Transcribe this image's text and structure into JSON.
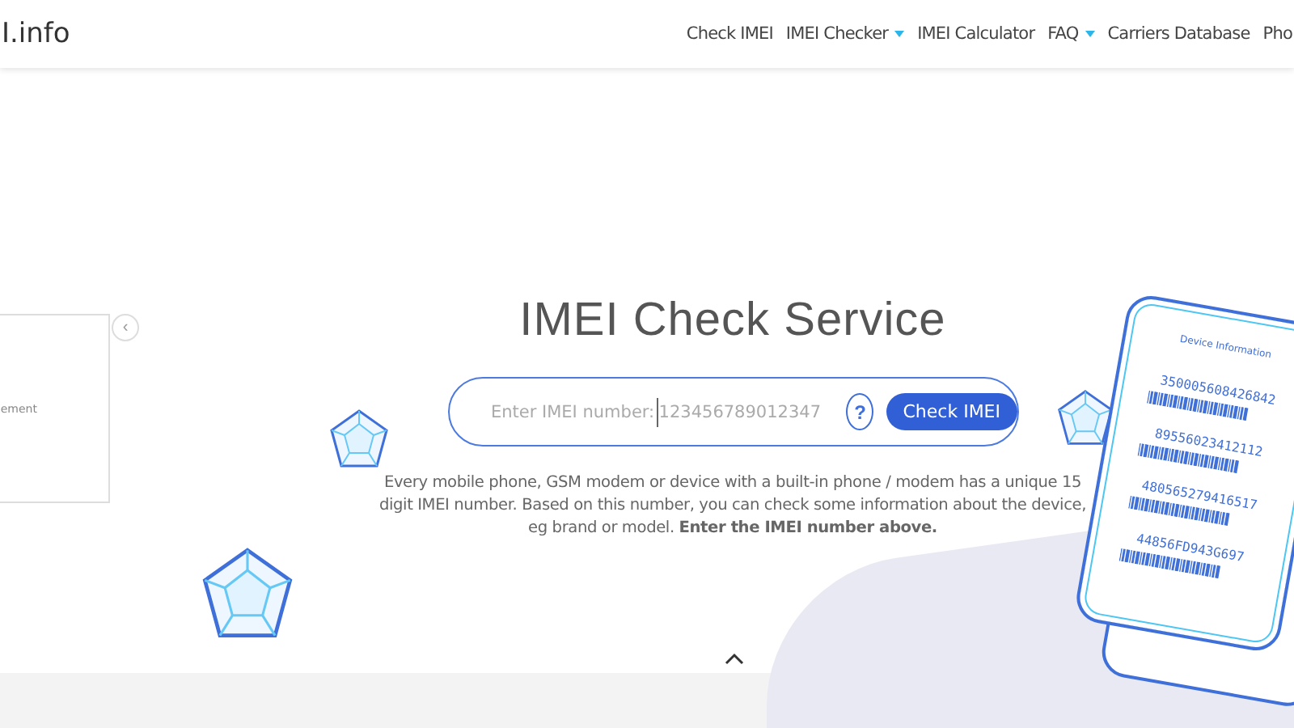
{
  "header": {
    "logo": "I.info",
    "nav": [
      {
        "label": "Check IMEI",
        "dropdown": false
      },
      {
        "label": "IMEI Checker",
        "dropdown": true
      },
      {
        "label": "IMEI Calculator",
        "dropdown": false
      },
      {
        "label": "FAQ",
        "dropdown": true
      },
      {
        "label": "Carriers Database",
        "dropdown": false
      },
      {
        "label": "Pho",
        "dropdown": false
      }
    ]
  },
  "side_panel": {
    "text": "ement",
    "collapse_button": "‹"
  },
  "hero": {
    "title": "IMEI Check Service",
    "search": {
      "label": "Enter IMEI number:",
      "placeholder": "123456789012347",
      "help": "?",
      "button": "Check IMEI"
    },
    "description": "Every mobile phone, GSM modem or device with a built-in phone / modem has a unique 15 digit IMEI number. Based on this number, you can check some information about the device, eg brand or model. **Enter the IMEI number above.**"
  },
  "phone": {
    "title": "Device Information",
    "numbers": [
      "350005608426842",
      "89556023412112",
      "480565279416517",
      "44856FD943G697"
    ]
  }
}
